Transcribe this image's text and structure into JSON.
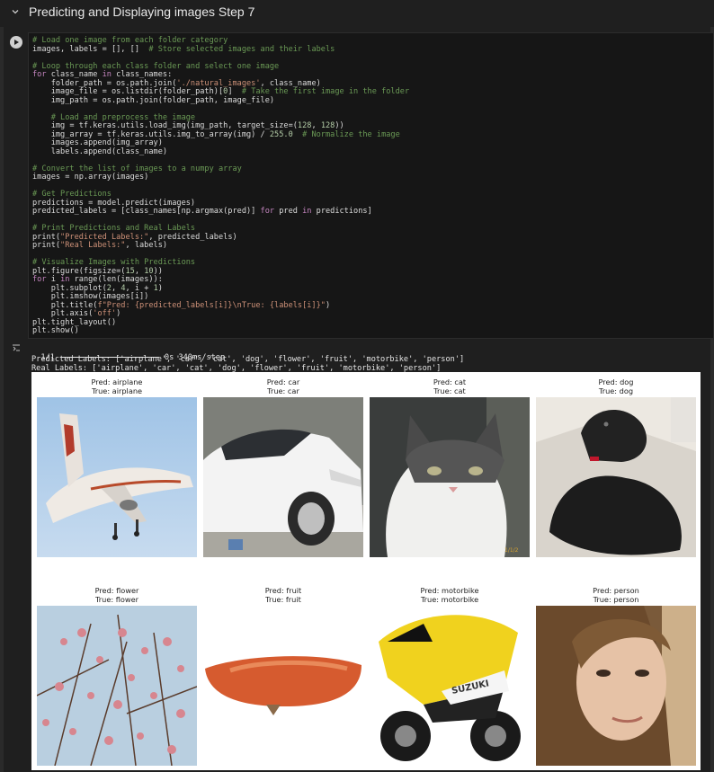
{
  "section": {
    "title": "Predicting and Displaying images Step 7",
    "collapse_icon": "chevron-down-icon"
  },
  "cell": {
    "run_icon": "play-icon",
    "code_lines": [
      "# Load one image from each folder category",
      "images, labels = [], []  # Store selected images and their labels",
      "",
      "# Loop through each class folder and select one image",
      "for class_name in class_names:",
      "    folder_path = os.path.join('./natural_images', class_name)",
      "    image_file = os.listdir(folder_path)[0]  # Take the first image in the folder",
      "    img_path = os.path.join(folder_path, image_file)",
      "",
      "    # Load and preprocess the image",
      "    img = tf.keras.utils.load_img(img_path, target_size=(128, 128))",
      "    img_array = tf.keras.utils.img_to_array(img) / 255.0  # Normalize the image",
      "    images.append(img_array)",
      "    labels.append(class_name)",
      "",
      "# Convert the list of images to a numpy array",
      "images = np.array(images)",
      "",
      "# Get Predictions",
      "predictions = model.predict(images)",
      "predicted_labels = [class_names[np.argmax(pred)] for pred in predictions]",
      "",
      "# Print Predictions and Real Labels",
      "print(\"Predicted Labels:\", predicted_labels)",
      "print(\"Real Labels:\", labels)",
      "",
      "# Visualize Images with Predictions",
      "plt.figure(figsize=(15, 10))",
      "for i in range(len(images)):",
      "    plt.subplot(2, 4, i + 1)",
      "    plt.imshow(images[i])",
      "    plt.title(f\"Pred: {predicted_labels[i]}\\nTrue: {labels[i]}\")",
      "    plt.axis('off')",
      "plt.tight_layout()",
      "plt.show()"
    ]
  },
  "output": {
    "icon": "output-icon",
    "progress_prefix": "1/1",
    "progress_suffix": "0s 340ms/step",
    "predicted_line": "Predicted Labels: ['airplane', 'car', 'cat', 'dog', 'flower', 'fruit', 'motorbike', 'person']",
    "real_line": "Real Labels: ['airplane', 'car', 'cat', 'dog', 'flower', 'fruit', 'motorbike', 'person']"
  },
  "subplots": [
    {
      "pred": "Pred: airplane",
      "true": "True: airplane",
      "image": "airplane-image"
    },
    {
      "pred": "Pred: car",
      "true": "True: car",
      "image": "car-image"
    },
    {
      "pred": "Pred: cat",
      "true": "True: cat",
      "image": "cat-image"
    },
    {
      "pred": "Pred: dog",
      "true": "True: dog",
      "image": "dog-image"
    },
    {
      "pred": "Pred: flower",
      "true": "True: flower",
      "image": "flower-image"
    },
    {
      "pred": "Pred: fruit",
      "true": "True: fruit",
      "image": "fruit-image"
    },
    {
      "pred": "Pred: motorbike",
      "true": "True: motorbike",
      "image": "motorbike-image"
    },
    {
      "pred": "Pred: person",
      "true": "True: person",
      "image": "person-image"
    }
  ]
}
